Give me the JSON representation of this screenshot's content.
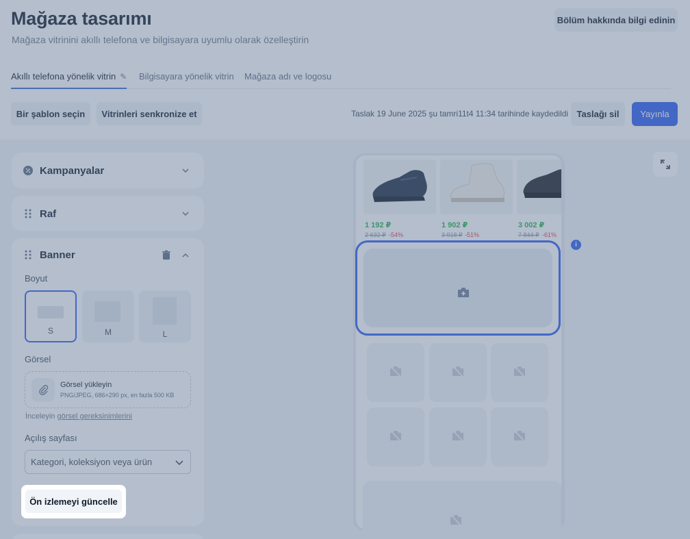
{
  "page": {
    "title": "Mağaza tasarımı",
    "subtitle": "Mağaza vitrinini akıllı telefona ve bilgisayara uyumlu olarak özelleştirin",
    "info_button": "Bölüm hakkında bilgi edinin"
  },
  "tabs": [
    {
      "label": "Akıllı telefona yönelik vitrin",
      "active": true
    },
    {
      "label": "Bilgisayara yönelik vitrin",
      "active": false
    },
    {
      "label": "Mağaza adı ve logosu",
      "active": false
    }
  ],
  "toolbar": {
    "template_button": "Bir şablon seçin",
    "sync_button": "Vitrinleri senkronize et",
    "draft_status": "Taslak 19 June 2025 şu tamri11t4 11:34 tarihinde kaydedildi",
    "delete_draft_button": "Taslağı sil",
    "publish_button": "Yayınla"
  },
  "sidebar": {
    "sections": [
      {
        "title": "Kampanyalar",
        "expanded": false
      },
      {
        "title": "Raf",
        "expanded": false
      },
      {
        "title": "Banner",
        "expanded": true
      }
    ],
    "banner": {
      "size_label": "Boyut",
      "sizes": [
        "S",
        "M",
        "L"
      ],
      "selected_size": "S",
      "image_label": "Görsel",
      "upload_title": "Görsel yükleyin",
      "upload_hint": "PNG/JPEG, 686×290 px, en fazla 500 KB",
      "requirements_prefix": "İnceleyin",
      "requirements_link": "görsel gereksinimlerini",
      "landing_label": "Açılış sayfası",
      "landing_placeholder": "Kategori, koleksiyon veya ürün"
    },
    "update_preview_button": "Ön izlemeyi güncelle"
  },
  "preview": {
    "products": [
      {
        "price": "1 192 ₽",
        "old_price": "2 632 ₽",
        "discount": "-54%"
      },
      {
        "price": "1 902 ₽",
        "old_price": "3 918 ₽",
        "discount": "-51%"
      },
      {
        "price": "3 002 ₽",
        "old_price": "7 844 ₽",
        "discount": "-61%"
      }
    ],
    "info_badge": "i"
  },
  "colors": {
    "accent": "#2a5cf0",
    "price_green": "#27b04d",
    "discount_red": "#e0384a",
    "overlay": "#607492"
  }
}
